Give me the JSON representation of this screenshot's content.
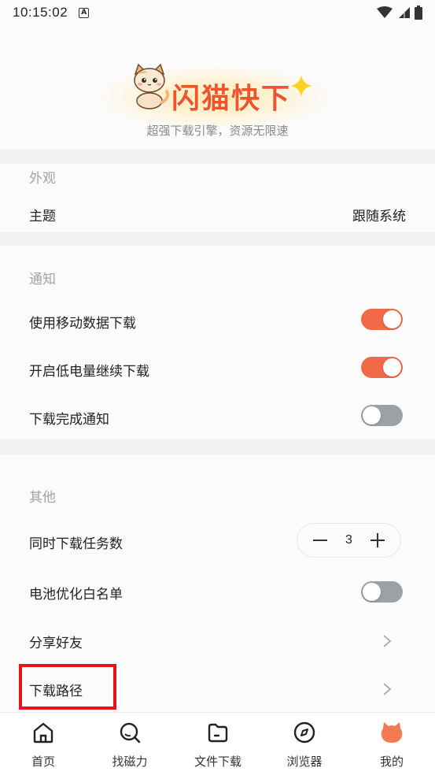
{
  "status_bar": {
    "time": "10:15:02",
    "notification_badge": "A"
  },
  "header": {
    "app_name": "闪猫快下",
    "tagline": "超强下载引擎，资源无限速"
  },
  "appearance": {
    "section_title": "外观",
    "theme_label": "主题",
    "theme_value": "跟随系统"
  },
  "notifications": {
    "section_title": "通知",
    "mobile_data_label": "使用移动数据下载",
    "mobile_data_on": true,
    "low_battery_label": "开启低电量继续下载",
    "low_battery_on": true,
    "download_complete_label": "下载完成通知",
    "download_complete_on": false
  },
  "other": {
    "section_title": "其他",
    "concurrent_label": "同时下载任务数",
    "concurrent_value": "3",
    "battery_whitelist_label": "电池优化白名单",
    "battery_whitelist_on": false,
    "share_label": "分享好友",
    "download_path_label": "下载路径"
  },
  "tabs": [
    {
      "label": "首页",
      "icon": "home-icon"
    },
    {
      "label": "找磁力",
      "icon": "search-icon"
    },
    {
      "label": "文件下载",
      "icon": "folder-icon"
    },
    {
      "label": "浏览器",
      "icon": "compass-icon"
    },
    {
      "label": "我的",
      "icon": "cat-avatar-icon"
    }
  ],
  "colors": {
    "accent": "#f16a48",
    "brand_text": "#f0552a",
    "toggle_off": "#9ea0a7",
    "highlight_box": "#e8121c"
  }
}
